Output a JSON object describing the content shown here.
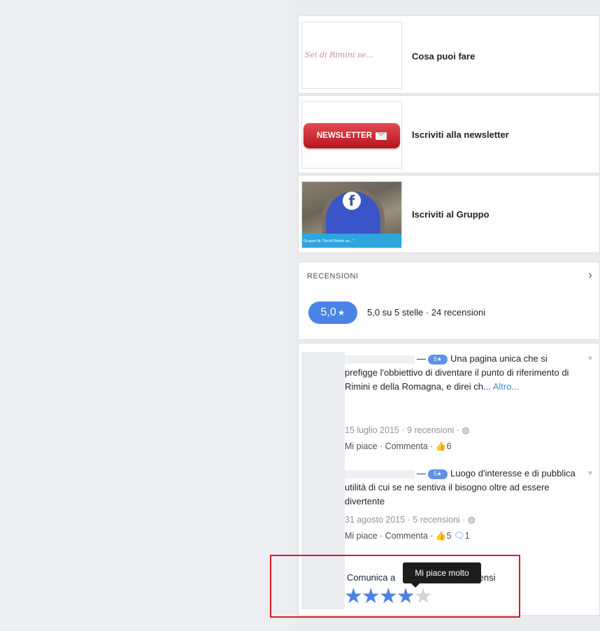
{
  "promos": [
    {
      "label": "Cosa puoi fare",
      "thumb_text": "Sei di Rimini se..."
    },
    {
      "label": "Iscriviti alla newsletter",
      "thumb_text": "NEWSLETTER"
    },
    {
      "label": "Iscriviti al Gruppo",
      "thumb_text": "Gruppo fb \"Sei di Rimini se...\"",
      "logo_text": "f"
    }
  ],
  "reviews_section": {
    "title": "RECENSIONI",
    "score": "5,0",
    "summary": "5,0 su 5 stelle · 24 recensioni",
    "items": [
      {
        "badge": "5★",
        "text": "Una pagina unica che si prefigge l'obbiettivo di diventare il punto di riferimento di Rimini e della Romagna, e direi ch...",
        "more": "Altro...",
        "meta": "15 luglio 2015 · 9 recensioni · ",
        "like_label": "Mi piace",
        "comment_label": "Commenta",
        "likes": "6",
        "comments": ""
      },
      {
        "badge": "5★",
        "text": "Luogo d'interesse e di pubblica utilità di cui se ne sentiva il bisogno oltre ad essere divertente",
        "more": "",
        "meta": "31 agosto 2015 · 5 recensioni · ",
        "like_label": "Mi piace",
        "comment_label": "Commenta",
        "likes": "5",
        "comments": "1"
      }
    ],
    "compose_prefix": "Comunica a",
    "compose_suffix": "pensi",
    "tooltip": "Mi piace molto",
    "star_rating": 4,
    "star_max": 5
  },
  "colors": {
    "accent": "#4a83e6",
    "highlight": "#d21f26"
  },
  "icons": [
    "chevron-right-icon",
    "chevron-down-icon",
    "globe-icon",
    "thumbs-up-icon",
    "comment-icon",
    "star-icon",
    "envelope-icon"
  ]
}
